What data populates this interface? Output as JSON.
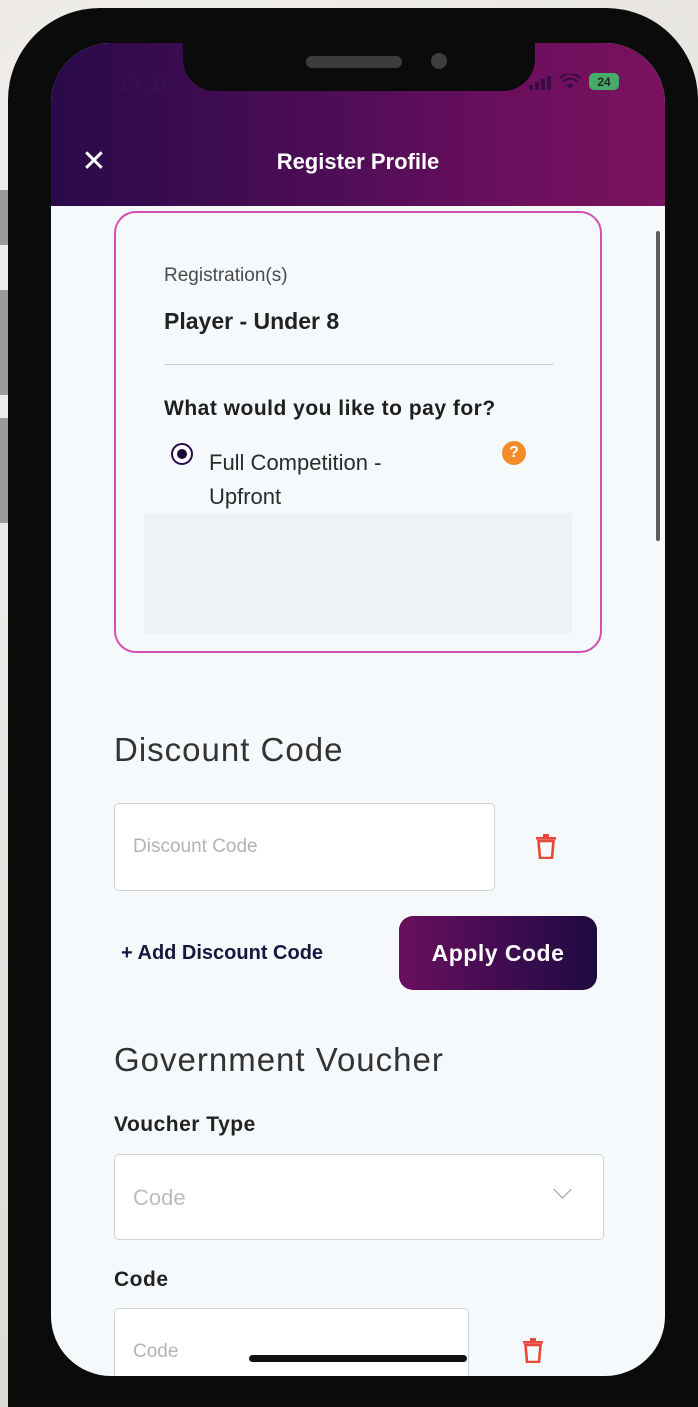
{
  "status_bar": {
    "time": "13:10",
    "battery": "24"
  },
  "header": {
    "title": "Register Profile"
  },
  "registration_card": {
    "label": "Registration(s)",
    "value": "Player - Under 8",
    "question": "What would you like to pay for?",
    "options": [
      {
        "label": "Full Competition - Upfront",
        "selected": true
      }
    ],
    "help_icon_text": "?"
  },
  "discount": {
    "title": "Discount Code",
    "input_placeholder": "Discount Code",
    "add_link": "+ Add Discount Code",
    "apply_button": "Apply Code"
  },
  "voucher": {
    "title": "Government Voucher",
    "type_label": "Voucher Type",
    "type_selected": "Code",
    "code_label": "Code",
    "code_placeholder": "Code"
  },
  "colors": {
    "header_gradient_start": "#2a0a4a",
    "header_gradient_end": "#7a1260",
    "card_border": "#d14fb8",
    "trash_red": "#e8483c",
    "help_orange": "#f28c28"
  }
}
